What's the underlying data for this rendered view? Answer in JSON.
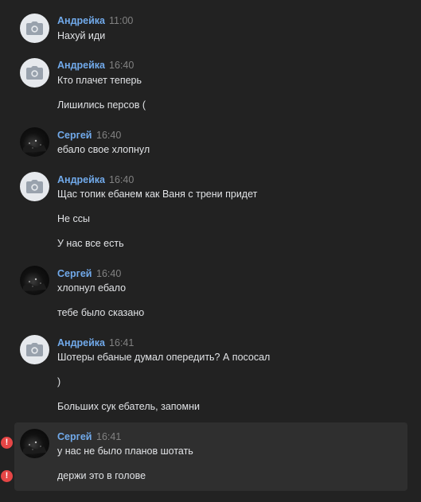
{
  "messages": [
    {
      "author": "Андрейка",
      "time": "11:00",
      "lines": [
        "Нахуй иди"
      ]
    },
    {
      "author": "Андрейка",
      "time": "16:40",
      "lines": [
        "Кто плачет теперь",
        "Лишились персов ("
      ]
    },
    {
      "author": "Сергей",
      "time": "16:40",
      "lines": [
        "ебало свое хлопнул"
      ]
    },
    {
      "author": "Андрейка",
      "time": "16:40",
      "lines": [
        "Щас топик ебанем как Ваня с трени придет",
        "Не ссы",
        "У нас все есть"
      ]
    },
    {
      "author": "Сергей",
      "time": "16:40",
      "lines": [
        "хлопнул ебало",
        "тебе было сказано"
      ]
    },
    {
      "author": "Андрейка",
      "time": "16:41",
      "lines": [
        "Шотеры ебаные думал опередить? А пососал",
        ")",
        "Больших сук ебатель, запомни"
      ]
    },
    {
      "author": "Сергей",
      "time": "16:41",
      "lines": [
        "у нас не было планов шотать",
        "держи это в голове"
      ]
    }
  ],
  "error_mark": "!",
  "icons": {
    "andreika_avatar": "camera-placeholder-icon",
    "sergey_avatar": "dark-photo",
    "error": "error-icon"
  },
  "colors": {
    "background": "#222222",
    "author_name": "#71aaeb",
    "text": "#e1e3e6",
    "time": "#828282",
    "error": "#e64646"
  }
}
